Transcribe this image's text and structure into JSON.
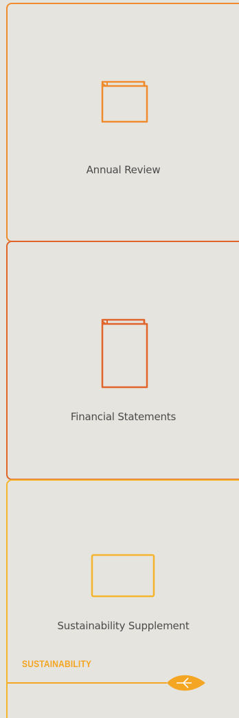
{
  "cards": [
    {
      "label": "Annual Review",
      "color": "#ef8b2c",
      "icon": "book-icon"
    },
    {
      "label": "Financial Statements",
      "color": "#e0632a",
      "icon": "book-icon"
    },
    {
      "label": "Sustainability Supplement",
      "color": "#f4b52c",
      "icon": "document-icon"
    }
  ],
  "badge": {
    "text": "SUSTAINABILITY",
    "icon": "leaf-icon",
    "color": "#f4a522"
  }
}
